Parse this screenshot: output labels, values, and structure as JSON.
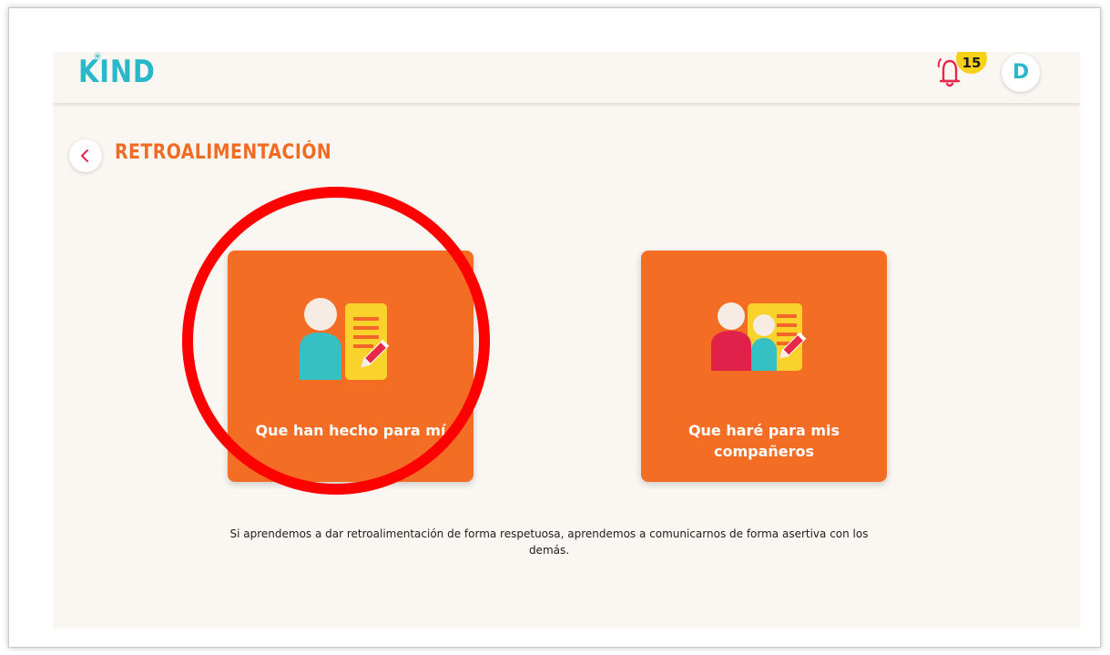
{
  "header": {
    "logo_text": "KIND",
    "notification_count": "15",
    "avatar_initial": "D"
  },
  "page": {
    "title": "RETROALIMENTACIÓN"
  },
  "cards": [
    {
      "label": "Que han hecho para mí",
      "icon": "person-feedback-icon"
    },
    {
      "label": "Que haré para mis compañeros",
      "icon": "group-feedback-icon"
    }
  ],
  "footnote": "Si aprendemos a dar retroalimentación de forma respetuosa, aprendemos a comunicarnos de forma asertiva con los demás.",
  "colors": {
    "accent_orange": "#f46d25",
    "brand_teal": "#29b8c9",
    "badge_yellow": "#f7d01a",
    "bell_red": "#e8274a",
    "highlight_red": "#ff0000"
  }
}
